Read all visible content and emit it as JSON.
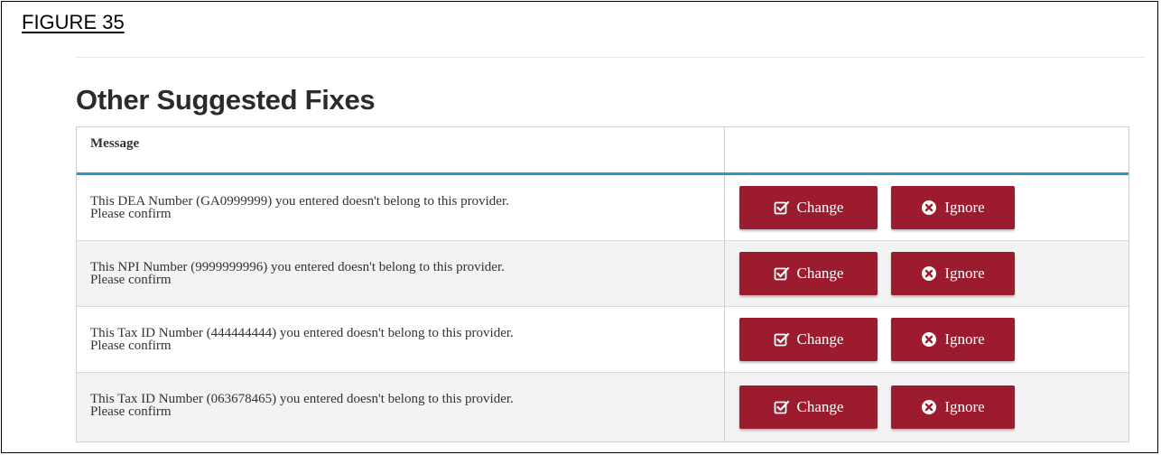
{
  "figure_label": "FIGURE 35",
  "heading": "Other Suggested Fixes",
  "table": {
    "header_message": "Message",
    "header_actions": "",
    "rows": [
      {
        "line1": "This DEA Number (GA0999999) you entered doesn't belong to this provider.",
        "line2": "Please confirm",
        "change_label": "Change",
        "ignore_label": "Ignore"
      },
      {
        "line1": "This NPI Number (9999999996) you entered doesn't belong to this provider.",
        "line2": "Please confirm",
        "change_label": "Change",
        "ignore_label": "Ignore"
      },
      {
        "line1": "This Tax ID Number (444444444) you entered doesn't belong to this provider.",
        "line2": "Please confirm",
        "change_label": "Change",
        "ignore_label": "Ignore"
      },
      {
        "line1": "This Tax ID Number (063678465) you entered doesn't belong to this provider.",
        "line2": "Please confirm",
        "change_label": "Change",
        "ignore_label": "Ignore"
      }
    ]
  },
  "icons": {
    "change": "checkbox-edit-icon",
    "ignore": "times-circle-icon"
  },
  "colors": {
    "button_bg": "#9d1b2f",
    "header_rule": "#2a96cf",
    "alt_row": "#f3f3f3"
  }
}
